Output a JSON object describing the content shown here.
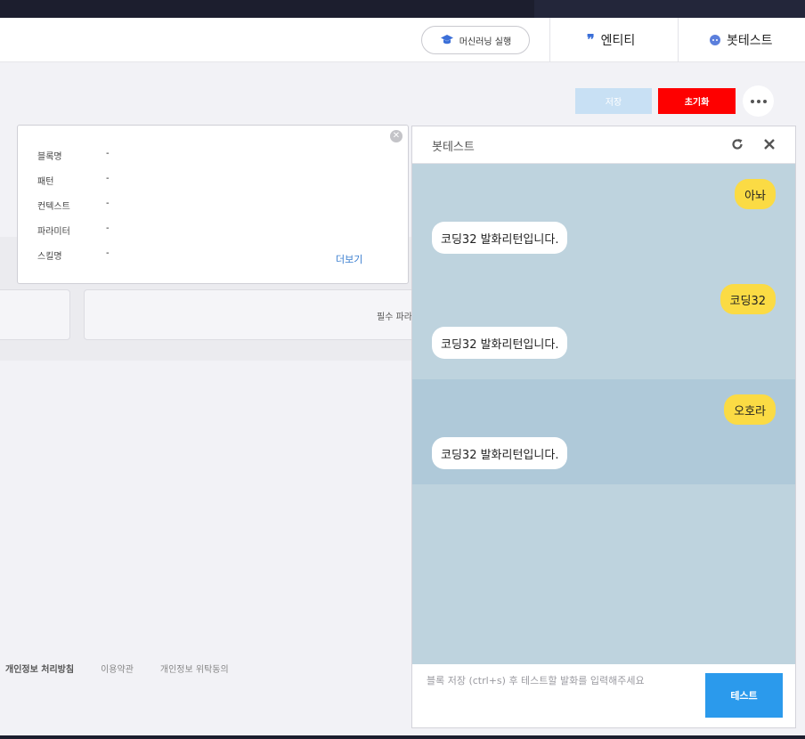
{
  "header": {
    "ml_button": "머신러닝 실행",
    "entity": "엔티티",
    "bottest": "봇테스트"
  },
  "toolbar": {
    "save_label": "저장",
    "reset_label": "초기화"
  },
  "info_popup": {
    "rows": [
      {
        "key": "블록명",
        "value": "-"
      },
      {
        "key": "패턴",
        "value": "-"
      },
      {
        "key": "컨텍스트",
        "value": "-"
      },
      {
        "key": "파라미터",
        "value": "-"
      },
      {
        "key": "스킬명",
        "value": "-"
      }
    ],
    "more_link": "더보기"
  },
  "main": {
    "card_label": "필수 파라"
  },
  "footer": {
    "privacy": "개인정보 처리방침",
    "terms": "이용약관",
    "consignment": "개인정보 위탁동의"
  },
  "bot_panel": {
    "title": "봇테스트",
    "messages": [
      {
        "user": "아놔",
        "bot": "코딩32 발화리턴입니다."
      },
      {
        "user": "코딩32",
        "bot": "코딩32 발화리턴입니다."
      },
      {
        "user": "오호라",
        "bot": "코딩32 발화리턴입니다."
      }
    ],
    "input_placeholder": "블록 저장 (ctrl+s) 후 테스트할 발화를 입력해주세요",
    "test_button": "테스트"
  },
  "colors": {
    "reset": "#fe0000",
    "save_disabled": "#c8e0f4",
    "test": "#2b9aec",
    "user_bubble": "#fbdb44",
    "chat_bg": "#bed3de"
  }
}
